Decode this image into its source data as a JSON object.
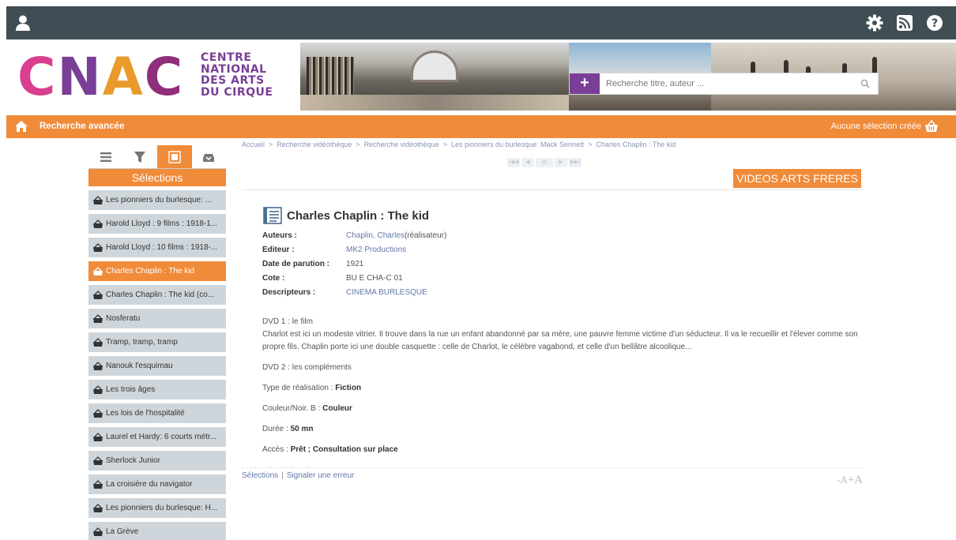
{
  "header": {
    "icons": [
      "user-icon",
      "gear-icon",
      "rss-icon",
      "help-icon"
    ]
  },
  "banner": {
    "logo": "CNAC",
    "logo_text": [
      "CENTRE",
      "NATIONAL",
      "DES ARTS",
      "DU CIRQUE"
    ],
    "search_placeholder": "Recherche titre, auteur ...",
    "search_plus": "+"
  },
  "navbar": {
    "advanced_search": "Recherche avancée",
    "selection_status": "Aucune sélection créée"
  },
  "sidebar": {
    "tabs": [
      "list-tab",
      "filter-tab",
      "selection-tab",
      "download-tab"
    ],
    "title": "Sélections",
    "items": [
      {
        "label": "Les pionniers du burlesque: ..."
      },
      {
        "label": "Harold Lloyd : 9 films : 1918-1..."
      },
      {
        "label": "Harold Lloyd : 10 films : 1918-..."
      },
      {
        "label": "Charles Chaplin : The kid"
      },
      {
        "label": "Charles Chaplin : The kid (co..."
      },
      {
        "label": "Nosferatu"
      },
      {
        "label": "Tramp, tramp, tramp"
      },
      {
        "label": "Nanouk l'esquimau"
      },
      {
        "label": "Les trois âges"
      },
      {
        "label": "Les lois de l'hospitalité"
      },
      {
        "label": "Laurel et Hardy: 6 courts métr..."
      },
      {
        "label": "Sherlock Junior"
      },
      {
        "label": "La croisière du navigator"
      },
      {
        "label": "Les pionniers du burlesque: H..."
      },
      {
        "label": "La Grève"
      }
    ],
    "active_index": 3
  },
  "breadcrumb": [
    "Accueil",
    "Recherche vidéothèque",
    "Recherche vidéothèque",
    "Les pionniers du burlesque: Mack Sennett",
    "Charles Chaplin : The kid"
  ],
  "pager": [
    "|◀◀",
    "◀",
    "▤",
    "▶",
    "▶▶|"
  ],
  "collection_button": "VIDEOS ARTS FRERES",
  "record": {
    "title": "Charles Chaplin : The kid",
    "fields": [
      {
        "label": "Auteurs :",
        "value": "Chaplin, Charles",
        "suffix": " (réalisateur)",
        "link": true
      },
      {
        "label": "Editeur :",
        "value": "MK2 Productions",
        "suffix": "",
        "link": true
      },
      {
        "label": "Date de parution :",
        "value": "1921",
        "suffix": "",
        "link": false
      },
      {
        "label": "Cote :",
        "value": "BU E CHA-C 01",
        "suffix": "",
        "link": false
      },
      {
        "label": "Descripteurs :",
        "value": "CINEMA BURLESQUE",
        "suffix": "",
        "link": true
      }
    ],
    "dvd1_heading": "DVD 1 : le film",
    "dvd1_text": "Charlot est ici un modeste vitrier. Il trouve dans la rue un enfant abandonné par sa mère, une pauvre femme victime d'un séducteur. Il va le recueillir et l'élever comme son propre fils. Chaplin porte ici une double casquette : celle de Charlot, le célèbre vagabond, et celle d'un bellâtre alcoolique...",
    "dvd2_heading": "DVD 2 : les compléments",
    "type_label": "Type de réalisation : ",
    "type_value": "Fiction",
    "color_label": "Couleur/Noir. B : ",
    "color_value": "Couleur",
    "duration_label": "Durée : ",
    "duration_value": "50 mn",
    "access_label": "Accès : ",
    "access_value": "Prêt ; Consultation sur place"
  },
  "footer": {
    "link1": "Sélections",
    "sep": "|",
    "link2": "Signaler une erreur",
    "font_small": "-A",
    "font_big": "+A"
  },
  "colors": {
    "topbar": "#3f4d54",
    "accent": "#f08b3a",
    "purple": "#7a3e96",
    "list_bg": "#cfd6db",
    "link": "#6278a8"
  }
}
